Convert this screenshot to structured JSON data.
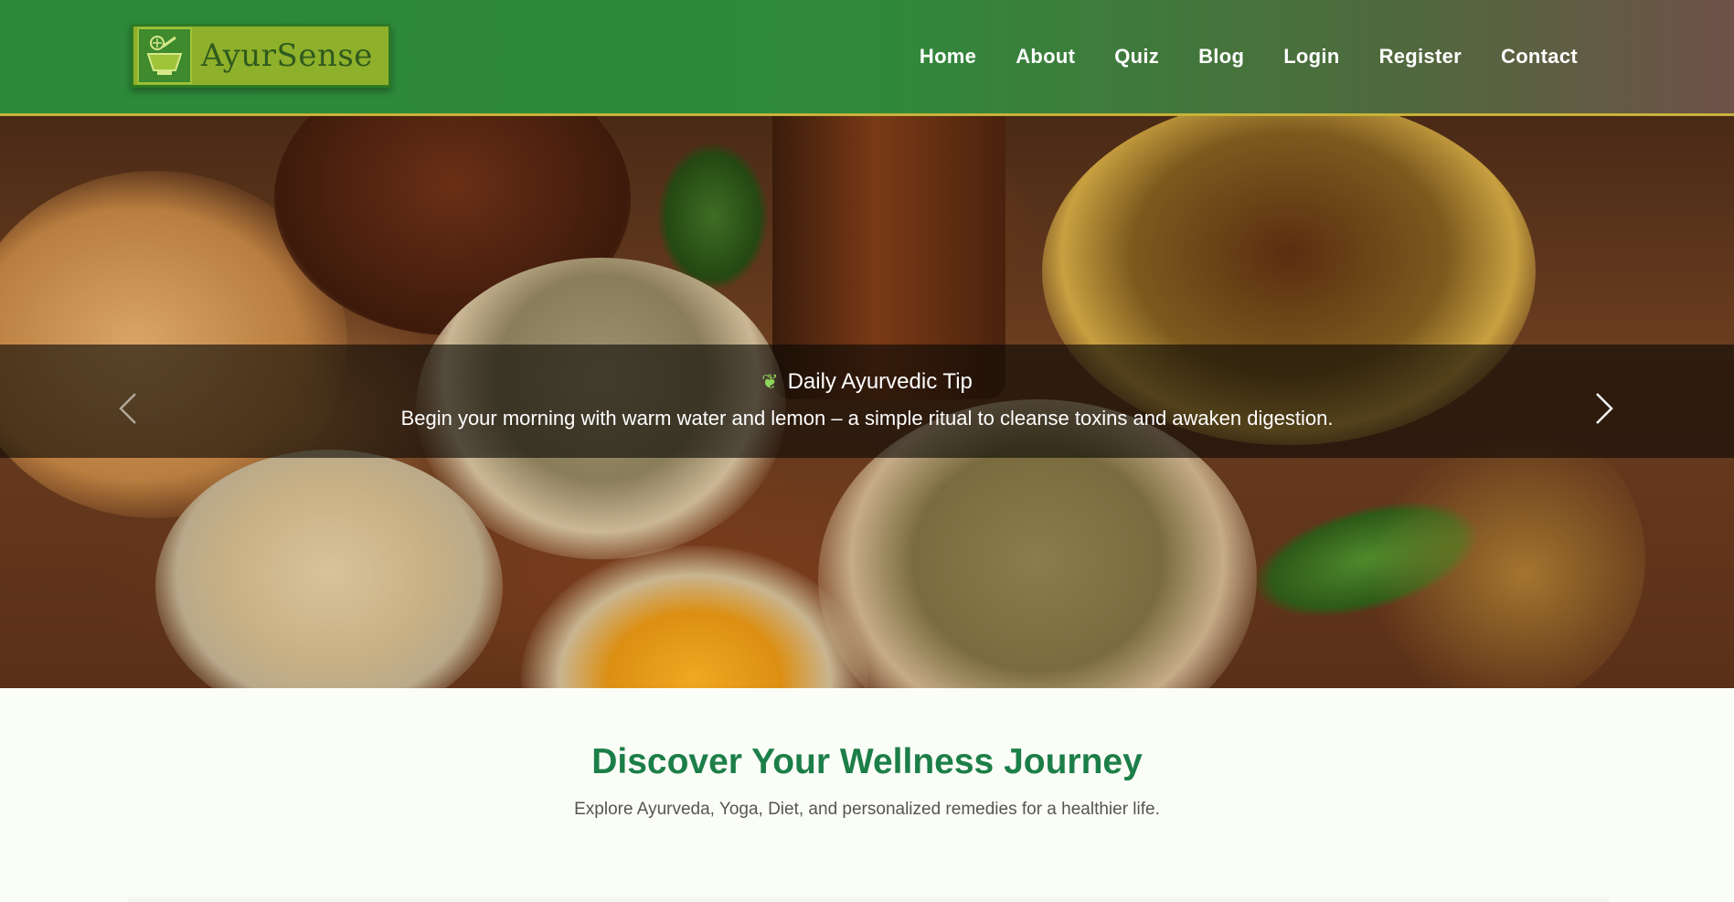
{
  "brand": {
    "name": "AyurSense"
  },
  "nav": {
    "items": [
      {
        "label": "Home"
      },
      {
        "label": "About"
      },
      {
        "label": "Quiz"
      },
      {
        "label": "Blog"
      },
      {
        "label": "Login"
      },
      {
        "label": "Register"
      },
      {
        "label": "Contact"
      }
    ]
  },
  "hero": {
    "tip_title": "Daily Ayurvedic Tip",
    "tip_text": "Begin your morning with warm water and lemon – a simple ritual to cleanse toxins and awaken digestion.",
    "prev_icon": "chevron-left-icon",
    "next_icon": "chevron-right-icon"
  },
  "section": {
    "title": "Discover Your Wellness Journey",
    "subtitle": "Explore Ayurveda, Yoga, Diet, and personalized remedies for a healthier life."
  },
  "colors": {
    "nav_green": "#2c8a3a",
    "nav_brown": "#6e5148",
    "accent_gold": "#c8b23a",
    "heading_green": "#1c7e48"
  }
}
